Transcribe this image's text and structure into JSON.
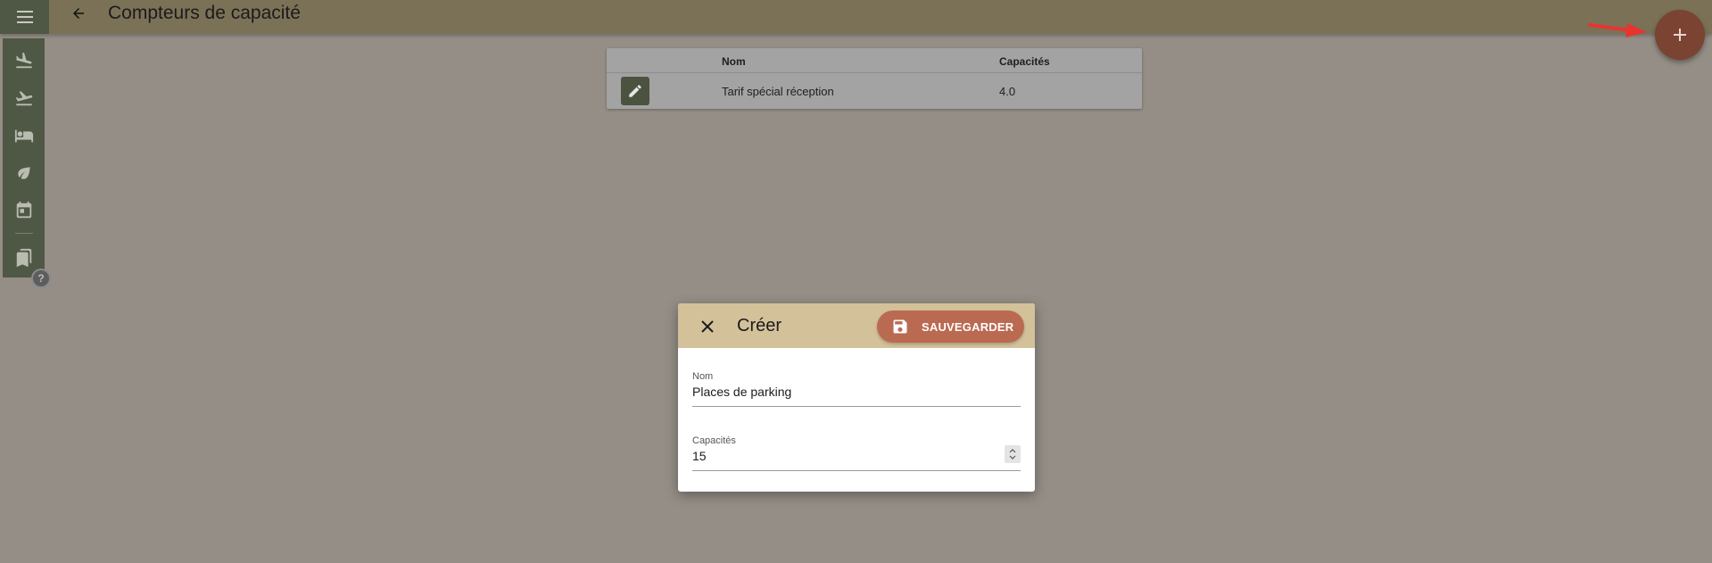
{
  "header": {
    "title": "Compteurs de capacité",
    "menu_icon": "hamburger-menu-icon",
    "back_icon": "arrow-back-icon"
  },
  "fab": {
    "icon": "plus-icon",
    "color": "#7a4332"
  },
  "sidenav": {
    "items": [
      {
        "name": "flight-land",
        "icon": "flight-land-icon"
      },
      {
        "name": "flight-takeoff",
        "icon": "flight-takeoff-icon"
      },
      {
        "name": "hotel",
        "icon": "bed-icon"
      },
      {
        "name": "eco",
        "icon": "leaf-icon"
      },
      {
        "name": "calendar",
        "icon": "calendar-icon"
      },
      {
        "name": "bookmarks",
        "icon": "bookmarks-icon"
      }
    ],
    "help_icon": "help-icon"
  },
  "table": {
    "columns": [
      "Nom",
      "Capacités"
    ],
    "rows": [
      {
        "nom": "Tarif spécial réception",
        "capacites": "4.0"
      }
    ]
  },
  "dialog": {
    "title": "Créer",
    "save_label": "SAUVEGARDER",
    "fields": {
      "nom": {
        "label": "Nom",
        "value": "Places de parking"
      },
      "capacites": {
        "label": "Capacités",
        "value": "15"
      }
    }
  },
  "colors": {
    "topbar": "#7b7157",
    "sidenav": "#4f5745",
    "dialog_header": "#d3c19a",
    "save_button": "#bb6a52",
    "fab": "#7a4332",
    "annotation_arrow": "#e8342e"
  }
}
